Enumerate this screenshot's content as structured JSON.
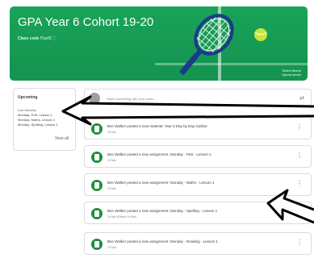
{
  "banner": {
    "title": "GPA Year 6 Cohort 19-20",
    "class_code_label": "Class code",
    "class_code_value": "f7pe5l ⛶",
    "select_theme": "Select theme",
    "upload_photo": "Upload photo",
    "colors": {
      "background": "#17a058",
      "accent": "#c8e63a"
    }
  },
  "upcoming": {
    "title": "Upcoming",
    "due_date": "Due Monday",
    "items": [
      "Monday- PaS- Lesson 1",
      "Monday- Maths- Lesson 1",
      "Monday- Spelling- Lesson 1"
    ],
    "view_all": "View all"
  },
  "share": {
    "placeholder": "Share something with your class..."
  },
  "stream": [
    {
      "text": "Ben Walker posted a new material: Year 6 Day by Day Outline",
      "date": "19 Mar"
    },
    {
      "text": "Ben Walker posted a new assignment: Monday - PaS - Lesson 1",
      "date": "19 Mar"
    },
    {
      "text": "Ben Walker posted a new assignment: Monday - Maths - Lesson 1",
      "date": "19 Mar"
    },
    {
      "text": "Ben Walker posted a new assignment: Monday - Spelling - Lesson 1",
      "date": "19 Mar (Edited 19 Mar)"
    },
    {
      "text": "Ben Walker posted a new assignment: Monday - Reading - Lesson 1",
      "date": "19 Mar"
    }
  ],
  "icons": {
    "share_icon": "repost-icon",
    "assignment_icon": "assignment-icon",
    "menu_icon": "more-vert-icon"
  }
}
